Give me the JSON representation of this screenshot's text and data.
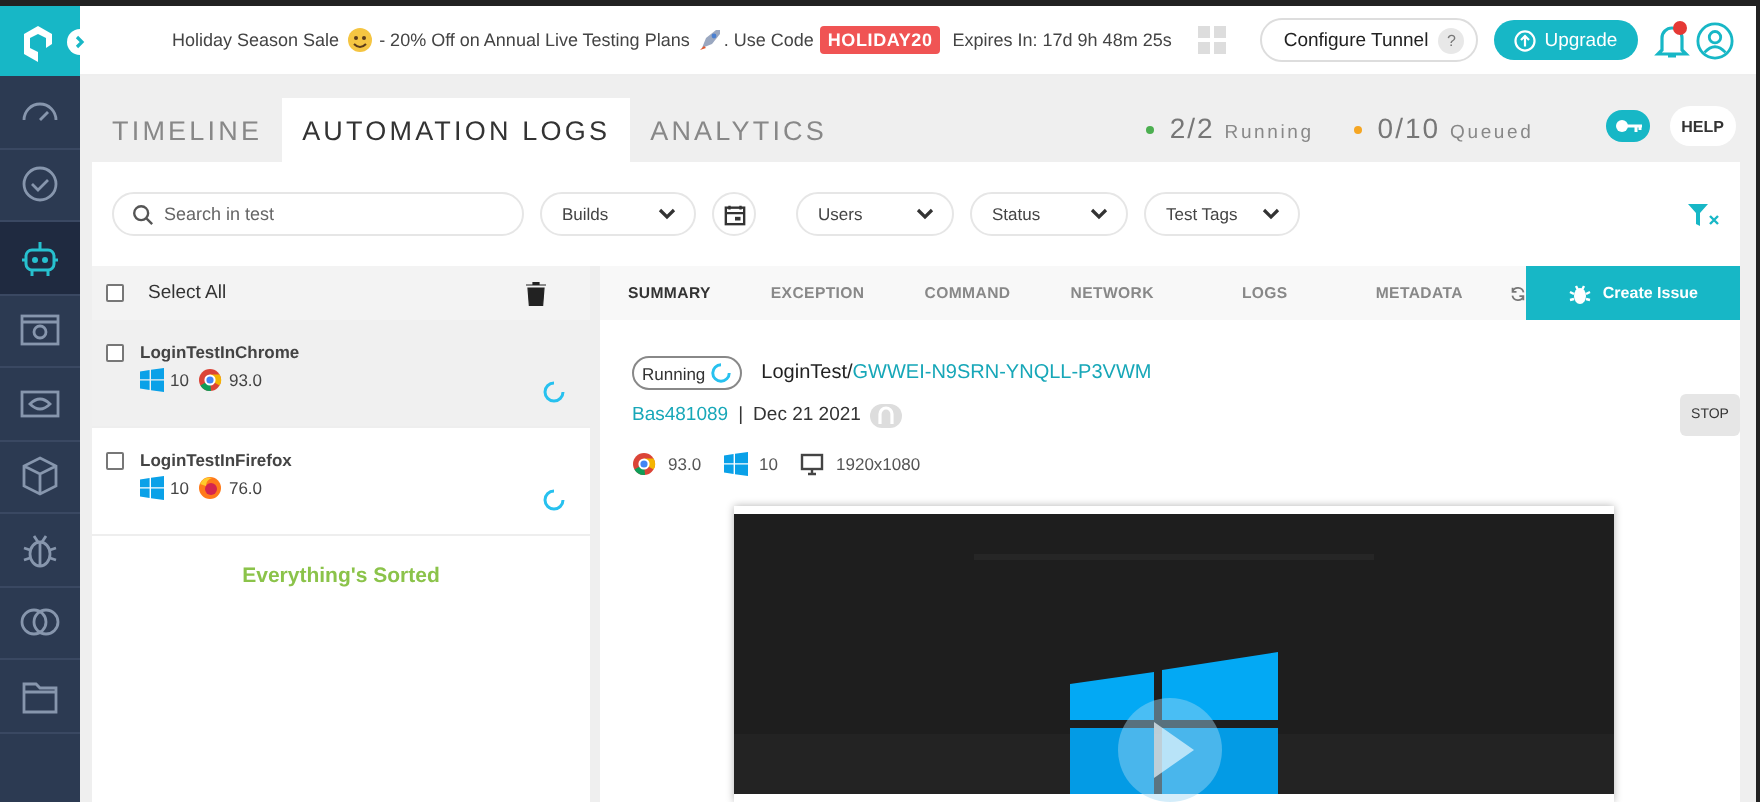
{
  "sidebar": {
    "items": [
      {
        "kind": "gauge",
        "selected": false
      },
      {
        "kind": "clock",
        "selected": false
      },
      {
        "kind": "robot",
        "selected": true
      },
      {
        "kind": "browser",
        "selected": false
      },
      {
        "kind": "eye",
        "selected": false
      },
      {
        "kind": "cube",
        "selected": false
      },
      {
        "kind": "bug",
        "selected": false
      },
      {
        "kind": "circles",
        "selected": false
      },
      {
        "kind": "folder",
        "selected": false
      }
    ]
  },
  "banner": {
    "lead": "Holiday Season Sale",
    "offer": "- 20% Off on Annual Live Testing Plans",
    "tail": ". Use Code",
    "code": "HOLIDAY20",
    "expiry": "Expires In: 17d 9h 48m 25s"
  },
  "header": {
    "configure_tunnel": "Configure Tunnel",
    "tunnel_help": "?",
    "upgrade": "Upgrade"
  },
  "tabs": [
    {
      "label": "TIMELINE",
      "selected": false
    },
    {
      "label": "AUTOMATION LOGS",
      "selected": true
    },
    {
      "label": "ANALYTICS",
      "selected": false
    }
  ],
  "stats": [
    {
      "value": "2/2",
      "label": "Running",
      "color": "#4caf50"
    },
    {
      "value": "0/10",
      "label": "Queued",
      "color": "#f5a623"
    }
  ],
  "help": "HELP",
  "filters": {
    "search_placeholder": "Search in test",
    "dropdowns": [
      {
        "kind": "select",
        "label": "Builds"
      },
      {
        "kind": "calendar"
      },
      {
        "kind": "select",
        "label": "Users"
      },
      {
        "kind": "select",
        "label": "Status"
      },
      {
        "kind": "select",
        "label": "Test Tags"
      }
    ]
  },
  "select_all": {
    "label": "Select All",
    "checked": false
  },
  "tests": [
    {
      "name": "LoginTestInChrome",
      "os_version": "10",
      "browser": {
        "kind": "chrome"
      },
      "browser_version": "93.0",
      "selected": true,
      "checked": false
    },
    {
      "name": "LoginTestInFirefox",
      "os_version": "10",
      "browser": {
        "kind": "firefox"
      },
      "browser_version": "76.0",
      "selected": false,
      "checked": false
    }
  ],
  "empty_message": "Everything's Sorted",
  "detail_tabs": [
    {
      "label": "SUMMARY",
      "selected": true
    },
    {
      "label": "EXCEPTION",
      "selected": false
    },
    {
      "label": "COMMAND",
      "selected": false
    },
    {
      "label": "NETWORK",
      "selected": false
    },
    {
      "label": "LOGS",
      "selected": false
    },
    {
      "label": "METADATA",
      "selected": false
    }
  ],
  "create_issue": "Create Issue",
  "detail": {
    "status": "Running",
    "test_name": "LoginTest/",
    "test_id": "GWWEI-N9SRN-YNQLL-P3VWM",
    "build": "Bas481089",
    "separator": "|",
    "date": "Dec 21 2021",
    "stop": "STOP",
    "browser": {
      "kind": "chrome"
    },
    "browser_version": "93.0",
    "os_version": "10",
    "resolution": "1920x1080"
  }
}
